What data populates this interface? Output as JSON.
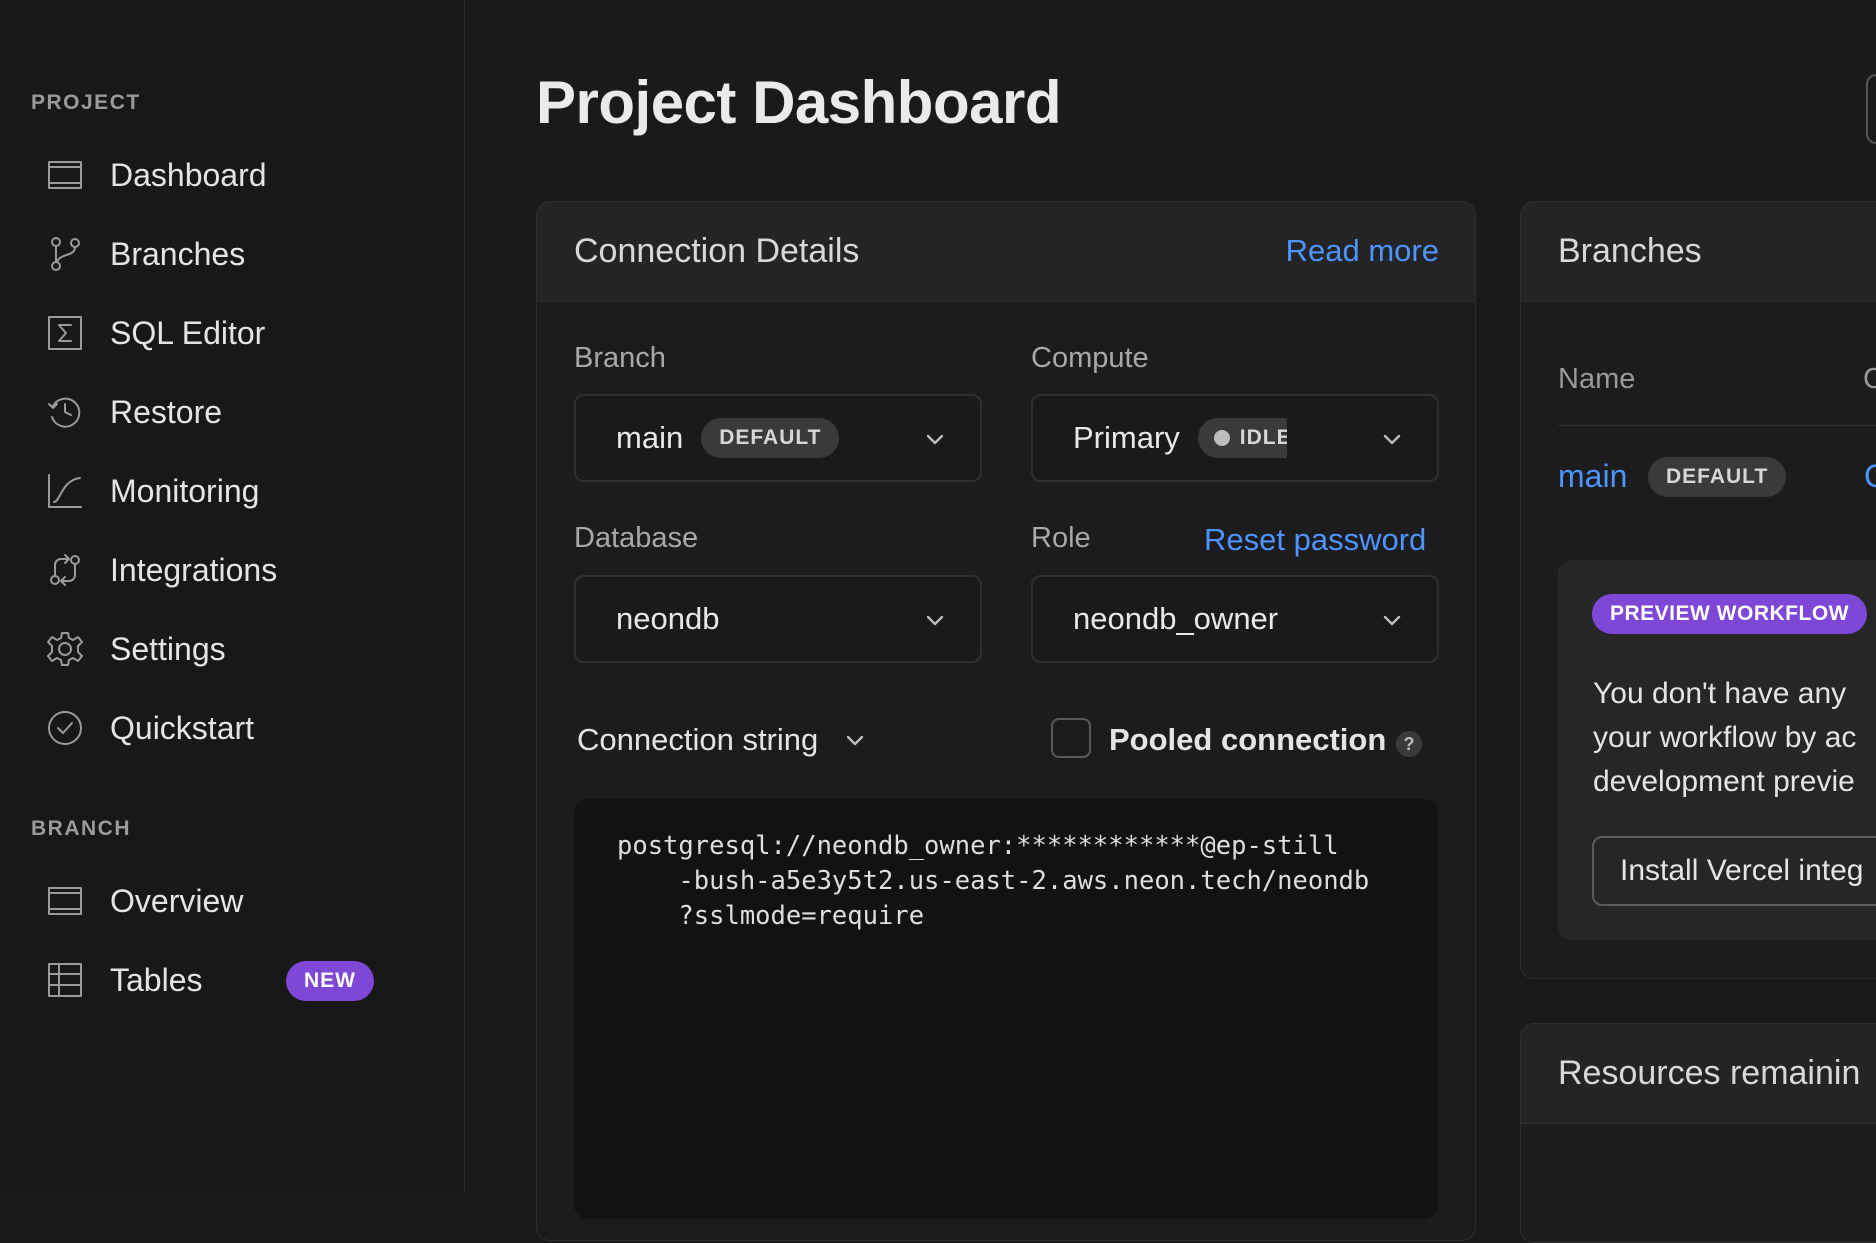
{
  "sidebar": {
    "project_label": "PROJECT",
    "project_items": [
      {
        "label": "Dashboard",
        "icon": "dashboard-icon"
      },
      {
        "label": "Branches",
        "icon": "branch-icon"
      },
      {
        "label": "SQL Editor",
        "icon": "sql-editor-icon"
      },
      {
        "label": "Restore",
        "icon": "restore-icon"
      },
      {
        "label": "Monitoring",
        "icon": "monitoring-icon"
      },
      {
        "label": "Integrations",
        "icon": "integrations-icon"
      },
      {
        "label": "Settings",
        "icon": "gear-icon"
      },
      {
        "label": "Quickstart",
        "icon": "check-circle-icon"
      }
    ],
    "branch_label": "BRANCH",
    "branch_items": [
      {
        "label": "Overview",
        "icon": "overview-icon"
      },
      {
        "label": "Tables",
        "icon": "table-icon",
        "badge": "NEW"
      }
    ]
  },
  "header": {
    "title": "Project Dashboard"
  },
  "connection": {
    "title": "Connection Details",
    "read_more": "Read more",
    "branch_label": "Branch",
    "branch_value": "main",
    "branch_badge": "DEFAULT",
    "compute_label": "Compute",
    "compute_value": "Primary",
    "compute_status": "IDLE",
    "database_label": "Database",
    "database_value": "neondb",
    "role_label": "Role",
    "reset_password": "Reset password",
    "role_value": "neondb_owner",
    "string_type": "Connection string",
    "pooled_label": "Pooled connection",
    "help": "?",
    "code": "postgresql://neondb_owner:************@ep-still\n    -bush-a5e3y5t2.us-east-2.aws.neon.tech/neondb\n    ?sslmode=require"
  },
  "branches": {
    "title": "Branches",
    "col_name": "Name",
    "col_2": "C",
    "row_name": "main",
    "row_badge": "DEFAULT",
    "row_col2": "C",
    "preview_badge": "PREVIEW WORKFLOW",
    "preview_text_1": "You don't have any",
    "preview_text_2": "your workflow by ac",
    "preview_text_3": "development previe",
    "install_button": "Install Vercel integ"
  },
  "resources": {
    "title": "Resources remainin"
  },
  "colors": {
    "accent": "#4d94ff",
    "badge_purple": "#7e47d6",
    "background": "#1a1a1a"
  }
}
